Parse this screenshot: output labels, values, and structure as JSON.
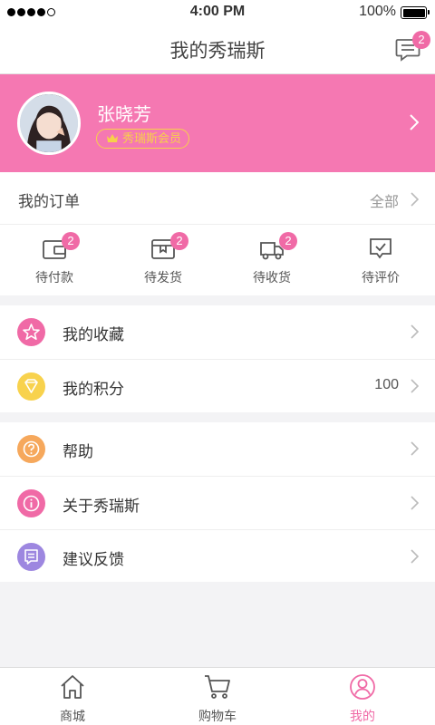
{
  "status_bar": {
    "time": "4:00 PM",
    "battery": "100%"
  },
  "nav": {
    "title": "我的秀瑞斯",
    "message_badge": "2"
  },
  "profile": {
    "name": "张晓芳",
    "membership": "秀瑞斯会员"
  },
  "orders": {
    "title": "我的订单",
    "view_all": "全部",
    "items": [
      {
        "label": "待付款",
        "badge": "2",
        "icon": "wallet-icon"
      },
      {
        "label": "待发货",
        "badge": "2",
        "icon": "package-icon"
      },
      {
        "label": "待收货",
        "badge": "2",
        "icon": "truck-icon"
      },
      {
        "label": "待评价",
        "badge": "",
        "icon": "review-icon"
      }
    ]
  },
  "menu_group1": [
    {
      "label": "我的收藏",
      "value": "",
      "icon": "star-icon",
      "color": "#f06aa6"
    },
    {
      "label": "我的积分",
      "value": "100",
      "icon": "diamond-icon",
      "color": "#f8d24d"
    }
  ],
  "menu_group2": [
    {
      "label": "帮助",
      "icon": "help-icon",
      "color": "#f6a85c"
    },
    {
      "label": "关于秀瑞斯",
      "icon": "info-icon",
      "color": "#f06aa6"
    },
    {
      "label": "建议反馈",
      "icon": "feedback-icon",
      "color": "#9d87e0"
    }
  ],
  "tabs": [
    {
      "label": "商城",
      "icon": "home-icon",
      "active": false
    },
    {
      "label": "购物车",
      "icon": "cart-icon",
      "active": false
    },
    {
      "label": "我的",
      "icon": "user-icon",
      "active": true
    }
  ],
  "colors": {
    "accent": "#f06aa6",
    "profile_bg": "#f578b2",
    "gold": "#f7d04a"
  }
}
